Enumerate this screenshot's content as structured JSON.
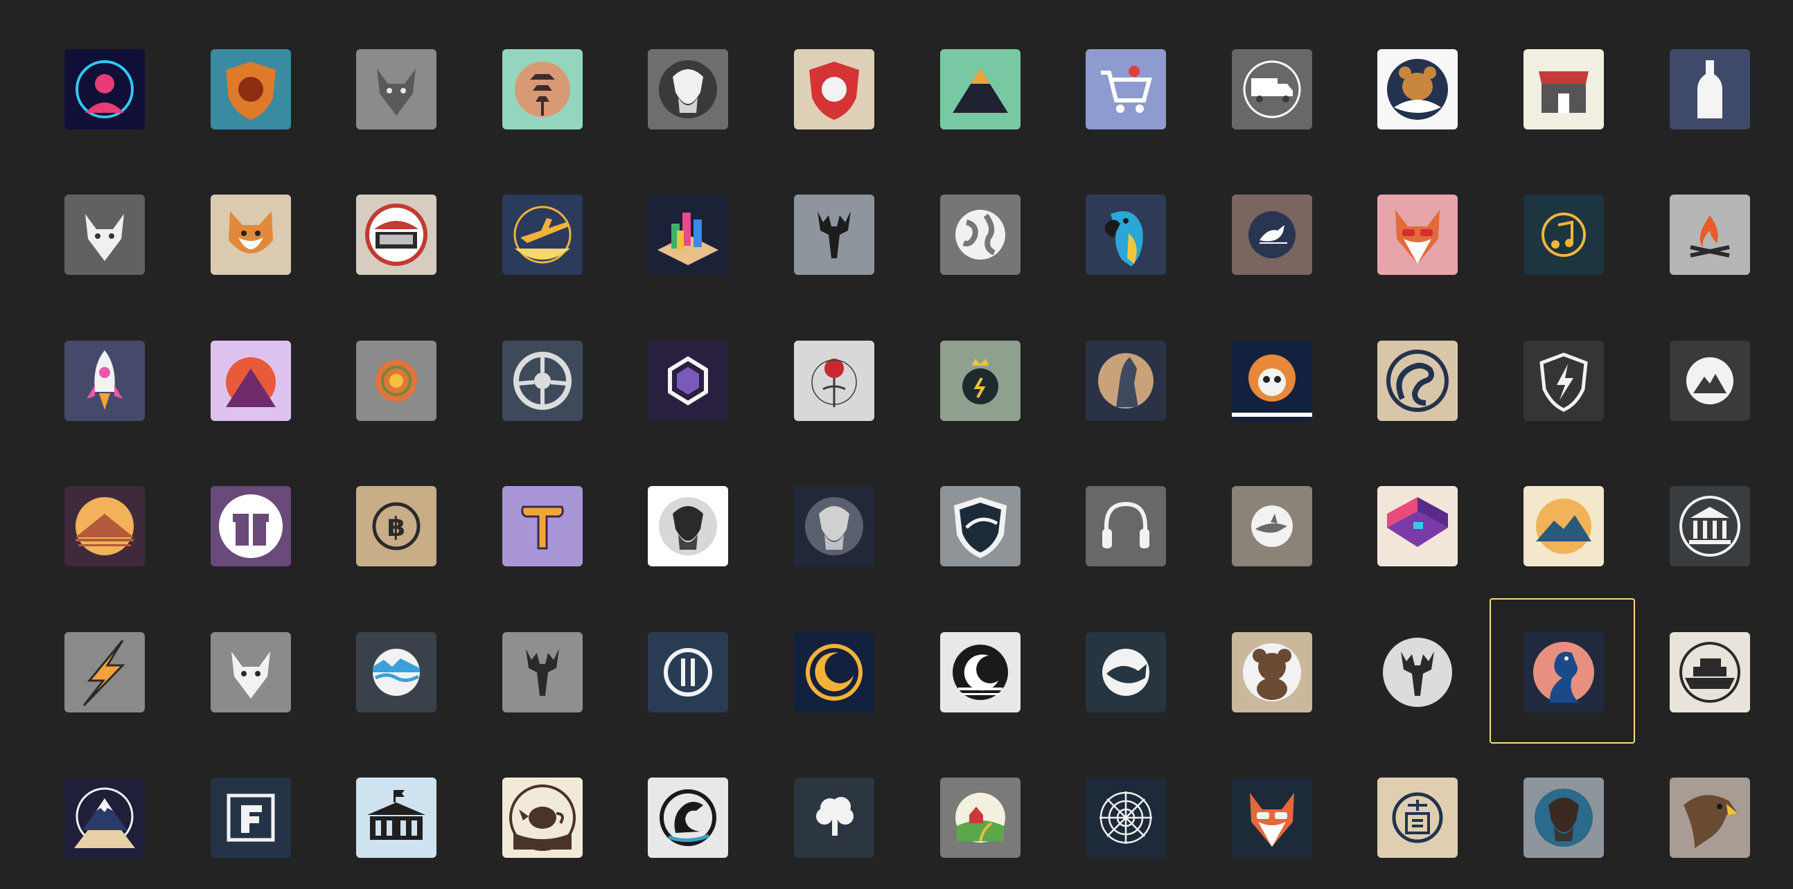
{
  "gallery": {
    "selected_index": 58,
    "icons": [
      {
        "name": "neon-portrait-icon",
        "bg": "#0f0f38",
        "type": "portrait",
        "fg": "#e83c76",
        "accent": "#32c8f0"
      },
      {
        "name": "lion-shield-icon",
        "bg": "#3a8aa2",
        "type": "shield",
        "fg": "#e07a2b",
        "accent": "#8c2e12"
      },
      {
        "name": "wolf-head-icon",
        "bg": "#8b8b8b",
        "type": "canine",
        "fg": "#5a5a5a",
        "accent": "#e8e8e8"
      },
      {
        "name": "pagoda-icon",
        "bg": "#93d6bd",
        "type": "pagoda",
        "fg": "#3f2a2a",
        "accent": "#e88b62"
      },
      {
        "name": "viking-head-icon",
        "bg": "#6e6e6e",
        "type": "face",
        "fg": "#f0f0f0",
        "accent": "#3a3a3a"
      },
      {
        "name": "lion-crest-icon",
        "bg": "#ddd0b6",
        "type": "shield",
        "fg": "#d43434",
        "accent": "#f2f2f2"
      },
      {
        "name": "mountain-icon",
        "bg": "#79c8a4",
        "type": "mountain",
        "fg": "#1f2230",
        "accent": "#f0a23a"
      },
      {
        "name": "shopping-cart-icon",
        "bg": "#8e9bd0",
        "type": "cart",
        "fg": "#ffffff",
        "accent": "#e83c3c"
      },
      {
        "name": "truck-icon",
        "bg": "#686868",
        "type": "truck",
        "fg": "#ffffff",
        "accent": "#3a3a3a"
      },
      {
        "name": "bear-icon",
        "bg": "#f7f7f7",
        "type": "bear",
        "fg": "#23324f",
        "accent": "#c8873d"
      },
      {
        "name": "storefront-icon",
        "bg": "#f2eee0",
        "type": "store",
        "fg": "#c83a3a",
        "accent": "#555555"
      },
      {
        "name": "bottle-icon",
        "bg": "#3f4a6a",
        "type": "bottle",
        "fg": "#f4f4f4",
        "accent": "#c8c8c8"
      },
      {
        "name": "fox-mask-icon",
        "bg": "#616161",
        "type": "canine",
        "fg": "#f0f0f0",
        "accent": "#333333"
      },
      {
        "name": "shiba-dog-icon",
        "bg": "#d9cab0",
        "type": "dog",
        "fg": "#e0893a",
        "accent": "#ffffff"
      },
      {
        "name": "stadium-icon",
        "bg": "#d6ccc0",
        "type": "stadium",
        "fg": "#c23b32",
        "accent": "#2a2a2a"
      },
      {
        "name": "airplane-icon",
        "bg": "#2a3b5c",
        "type": "plane",
        "fg": "#f2b23a",
        "accent": "#f6d86a"
      },
      {
        "name": "isometric-city-icon",
        "bg": "#1b2238",
        "type": "iso",
        "fg": "#39b36a",
        "accent": "#e84a8a"
      },
      {
        "name": "moose-head-icon",
        "bg": "#8f959c",
        "type": "deer",
        "fg": "#1d1d1d",
        "accent": "#1d1d1d"
      },
      {
        "name": "globe-icon",
        "bg": "#767676",
        "type": "globe",
        "fg": "#f1f1f1",
        "accent": "#767676"
      },
      {
        "name": "parrot-icon",
        "bg": "#2f3b56",
        "type": "parrot",
        "fg": "#2aa7d8",
        "accent": "#f3c63a"
      },
      {
        "name": "bird-badge-icon",
        "bg": "#7a6560",
        "type": "bird",
        "fg": "#ffffff",
        "accent": "#2a3552"
      },
      {
        "name": "fox-sunglasses-icon",
        "bg": "#e5a5ab",
        "type": "fox",
        "fg": "#e36b3a",
        "accent": "#d42e2e"
      },
      {
        "name": "music-note-icon",
        "bg": "#1d3441",
        "type": "music",
        "fg": "#f0b63a",
        "accent": "#1d3441"
      },
      {
        "name": "campfire-icon",
        "bg": "#b6b6b6",
        "type": "fire",
        "fg": "#e85b2a",
        "accent": "#2a2a2a"
      },
      {
        "name": "rocket-icon",
        "bg": "#454a6b",
        "type": "rocket",
        "fg": "#f2f2f2",
        "accent": "#e85aa8"
      },
      {
        "name": "sunset-peak-icon",
        "bg": "#ddc2f0",
        "type": "peak",
        "fg": "#e85a3a",
        "accent": "#6e2a6a"
      },
      {
        "name": "sun-disc-icon",
        "bg": "#8b8b8b",
        "type": "sun",
        "fg": "#e0743a",
        "accent": "#6a8a3a"
      },
      {
        "name": "steering-wheel-icon",
        "bg": "#3e4a5a",
        "type": "wheel",
        "fg": "#dcdcdc",
        "accent": "#3e4a5a"
      },
      {
        "name": "hexagon-icon",
        "bg": "#28203e",
        "type": "hex",
        "fg": "#f4f4f4",
        "accent": "#7a5ab8"
      },
      {
        "name": "rose-icon",
        "bg": "#d8d8d8",
        "type": "rose",
        "fg": "#c8282e",
        "accent": "#3a3a3a"
      },
      {
        "name": "crown-coin-icon",
        "bg": "#8fa08e",
        "type": "coin",
        "fg": "#1f2a2e",
        "accent": "#f0c23a"
      },
      {
        "name": "horse-badge-icon",
        "bg": "#2a3346",
        "type": "horse",
        "fg": "#c9a27a",
        "accent": "#3e4a5e"
      },
      {
        "name": "panda-badge-icon",
        "bg": "#12213e",
        "type": "panda",
        "fg": "#f2f2f2",
        "accent": "#e8893a"
      },
      {
        "name": "serpent-icon",
        "bg": "#d8c6a8",
        "type": "serpent",
        "fg": "#23324f",
        "accent": "#d8c6a8"
      },
      {
        "name": "shield-bolt-icon",
        "bg": "#353535",
        "type": "shieldbolt",
        "fg": "#f2f2f2",
        "accent": "#353535"
      },
      {
        "name": "mountain-circle-icon",
        "bg": "#3a3a3a",
        "type": "mtncircle",
        "fg": "#f2f2f2",
        "accent": "#3a3a3a"
      },
      {
        "name": "desert-sunset-icon",
        "bg": "#3e2a3a",
        "type": "sunset",
        "fg": "#f2b25a",
        "accent": "#b25a3a"
      },
      {
        "name": "gift-icon",
        "bg": "#6a4a7a",
        "type": "gift",
        "fg": "#ffffff",
        "accent": "#6a4a7a"
      },
      {
        "name": "bitcoin-icon",
        "bg": "#c9ad87",
        "type": "bitcoin",
        "fg": "#2a2a2a",
        "accent": "#c9ad87"
      },
      {
        "name": "hammer-icon",
        "bg": "#a996d6",
        "type": "hammer",
        "fg": "#f2a63a",
        "accent": "#3a2a4a"
      },
      {
        "name": "warrior-portrait-icon",
        "bg": "#ffffff",
        "type": "face",
        "fg": "#2a2a2a",
        "accent": "#d8d8d8"
      },
      {
        "name": "knight-bust-icon",
        "bg": "#222838",
        "type": "face",
        "fg": "#d0d0d0",
        "accent": "#5a6070"
      },
      {
        "name": "crest-shield-icon",
        "bg": "#8f9498",
        "type": "crest",
        "fg": "#1d2a3a",
        "accent": "#f2f2f2"
      },
      {
        "name": "headphones-icon",
        "bg": "#686868",
        "type": "headphones",
        "fg": "#f2f2f2",
        "accent": "#686868"
      },
      {
        "name": "shark-badge-icon",
        "bg": "#8a8478",
        "type": "shark",
        "fg": "#f2f2f2",
        "accent": "#6a6a6a"
      },
      {
        "name": "isometric-room-icon",
        "bg": "#f2e6da",
        "type": "room",
        "fg": "#7a3aa8",
        "accent": "#e84a7a"
      },
      {
        "name": "mountain-sun-icon",
        "bg": "#f4e8cc",
        "type": "mtnsun",
        "fg": "#2a5a7a",
        "accent": "#f2b25a"
      },
      {
        "name": "bank-icon",
        "bg": "#3a3d40",
        "type": "bank",
        "fg": "#f2f2f2",
        "accent": "#3a3d40"
      },
      {
        "name": "lightning-bolt-icon",
        "bg": "#8a8a8a",
        "type": "bolt",
        "fg": "#f2a23a",
        "accent": "#2a2a2a"
      },
      {
        "name": "wolf-outline-icon",
        "bg": "#8b8b8b",
        "type": "canine",
        "fg": "#f2f2f2",
        "accent": "#2a2a2a"
      },
      {
        "name": "waves-badge-icon",
        "bg": "#3a414a",
        "type": "waves",
        "fg": "#f2f2f2",
        "accent": "#3aa0d8"
      },
      {
        "name": "stag-head-icon",
        "bg": "#8f8f8f",
        "type": "deer",
        "fg": "#2a2a2a",
        "accent": "#f2f2f2"
      },
      {
        "name": "pause-circle-icon",
        "bg": "#2a3c54",
        "type": "pause",
        "fg": "#f2f2f2",
        "accent": "#2a3c54"
      },
      {
        "name": "crescent-ring-icon",
        "bg": "#12213e",
        "type": "crescent",
        "fg": "#f2b23a",
        "accent": "#12213e"
      },
      {
        "name": "night-moon-icon",
        "bg": "#e8e8e8",
        "type": "moon",
        "fg": "#1a1a1a",
        "accent": "#ffffff"
      },
      {
        "name": "whale-icon",
        "bg": "#263540",
        "type": "whale",
        "fg": "#f2f2f2",
        "accent": "#263540"
      },
      {
        "name": "teddy-bear-icon",
        "bg": "#c9b89c",
        "type": "teddy",
        "fg": "#6a4a32",
        "accent": "#f2f2f2"
      },
      {
        "name": "elk-badge-icon",
        "bg": "#232323",
        "type": "elk",
        "fg": "#dcdcdc",
        "accent": "#2a2a2a"
      },
      {
        "name": "peacock-icon",
        "bg": "#1f2a3e",
        "type": "peacock",
        "fg": "#e89080",
        "accent": "#1a4a8a"
      },
      {
        "name": "cruise-ship-icon",
        "bg": "#e8e4da",
        "type": "ship",
        "fg": "#2a2a2a",
        "accent": "#e8e4da"
      },
      {
        "name": "snowy-mountain-icon",
        "bg": "#1f1f3a",
        "type": "snowmtn",
        "fg": "#f2f2f2",
        "accent": "#e8d0a8"
      },
      {
        "name": "letter-f-icon",
        "bg": "#243446",
        "type": "letterf",
        "fg": "#f2f2f2",
        "accent": "#243446"
      },
      {
        "name": "museum-building-icon",
        "bg": "#cfe2f0",
        "type": "museum",
        "fg": "#1f1f1f",
        "accent": "#cfe2f0"
      },
      {
        "name": "teapot-icon",
        "bg": "#f2ead8",
        "type": "teapot",
        "fg": "#4a3428",
        "accent": "#f2ead8"
      },
      {
        "name": "dragon-icon",
        "bg": "#e8e8e8",
        "type": "dragon",
        "fg": "#1a1a1a",
        "accent": "#3aa0c8"
      },
      {
        "name": "tree-icon",
        "bg": "#2c3640",
        "type": "tree",
        "fg": "#f2f2f2",
        "accent": "#2c3640"
      },
      {
        "name": "farm-badge-icon",
        "bg": "#7a7a7a",
        "type": "farm",
        "fg": "#5aa84a",
        "accent": "#c83a3a"
      },
      {
        "name": "spider-web-icon",
        "bg": "#1d2a3a",
        "type": "web",
        "fg": "#f2f2f2",
        "accent": "#1d2a3a"
      },
      {
        "name": "fox-head-icon",
        "bg": "#1d2a3a",
        "type": "fox",
        "fg": "#e3683a",
        "accent": "#f2f2f2"
      },
      {
        "name": "kanji-seal-icon",
        "bg": "#dfcfb0",
        "type": "seal",
        "fg": "#23324f",
        "accent": "#dfcfb0"
      },
      {
        "name": "bearded-warrior-icon",
        "bg": "#8f959c",
        "type": "face",
        "fg": "#3a2a22",
        "accent": "#2a6a8a"
      },
      {
        "name": "eagle-head-icon",
        "bg": "#a89c94",
        "type": "eagle",
        "fg": "#6a4a32",
        "accent": "#f2f2f2"
      }
    ]
  }
}
